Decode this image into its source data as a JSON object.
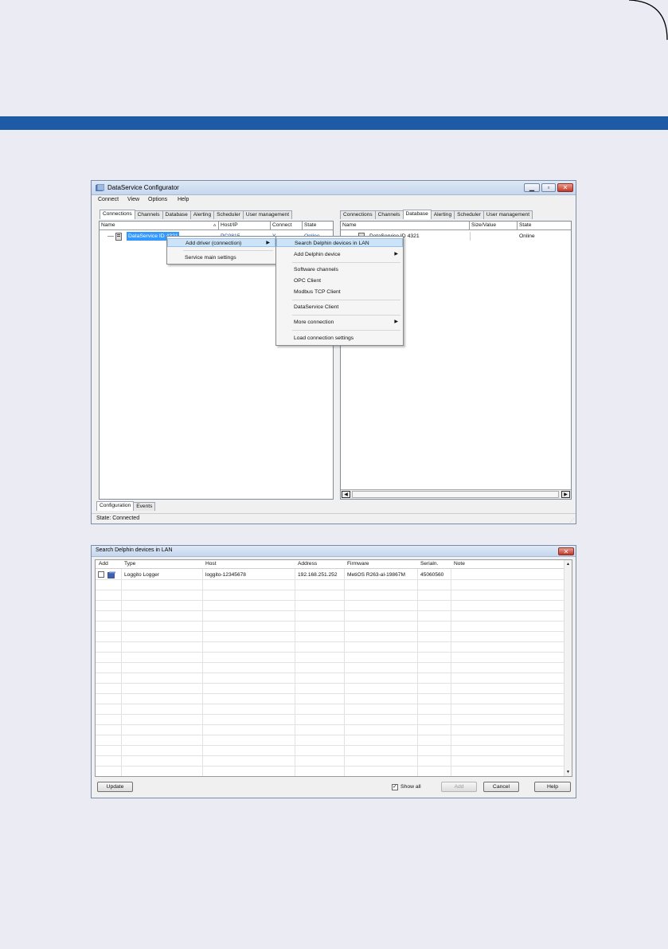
{
  "main_window": {
    "title": "DataService Configurator",
    "menu": [
      "Connect",
      "View",
      "Options",
      "Help"
    ],
    "left_tabs": [
      "Connections",
      "Channels",
      "Database",
      "Alerting",
      "Scheduler",
      "User management"
    ],
    "right_tabs": [
      "Connections",
      "Channels",
      "Database",
      "Alerting",
      "Scheduler",
      "User management"
    ],
    "left_columns": [
      "Name",
      "Host/IP",
      "Connect",
      "State"
    ],
    "right_columns": [
      "Name",
      "Size/Value",
      "State"
    ],
    "left_row": {
      "name": "DataService ID 4321",
      "host": "PC0815",
      "connect": "Y",
      "state": "Online"
    },
    "right_row": {
      "name": "DataService ID 4321",
      "state": "Online"
    },
    "bottom_tabs": [
      "Configuration",
      "Events"
    ],
    "status": "State: Connected"
  },
  "context_menu": {
    "items": [
      "Add driver (connection)",
      "Service main settings"
    ]
  },
  "submenu": {
    "items": [
      "Search Delphin devices in LAN",
      "Add Delphin device",
      "Software channels",
      "OPC Client",
      "Modbus TCP Client",
      "DataService Client",
      "More connection",
      "Load connection settings"
    ]
  },
  "dialog": {
    "title": "Search Delphin devices in LAN",
    "columns": [
      "Add",
      "Type",
      "Host",
      "Address",
      "Firmware",
      "Serialn.",
      "Note"
    ],
    "rows": [
      {
        "type": "Loggito Logger",
        "host": "loggito-12345678",
        "address": "192.168.251.252",
        "firmware": "MetiOS R263-al-19867M",
        "serial": "45060560",
        "note": ""
      }
    ],
    "buttons": {
      "update": "Update",
      "show_all": "Show all",
      "add": "Add",
      "cancel": "Cancel",
      "help": "Help"
    }
  }
}
